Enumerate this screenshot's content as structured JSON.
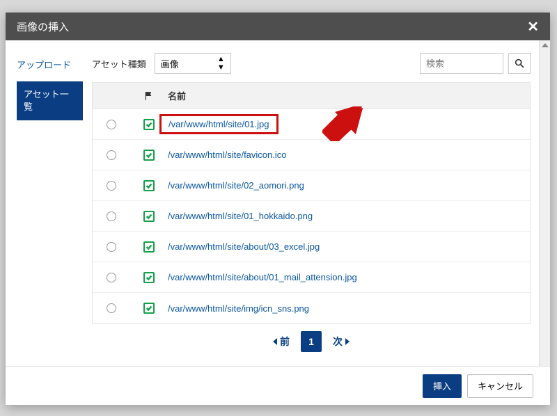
{
  "modal": {
    "title": "画像の挿入"
  },
  "sidebar": {
    "upload_label": "アップロード",
    "asset_list_label": "アセット一覧"
  },
  "toolbar": {
    "asset_type_label": "アセット種類",
    "asset_type_value": "画像",
    "search_placeholder": "検索"
  },
  "table": {
    "name_header": "名前",
    "rows": [
      {
        "name": "/var/www/html/site/01.jpg",
        "highlight": true
      },
      {
        "name": "/var/www/html/site/favicon.ico"
      },
      {
        "name": "/var/www/html/site/02_aomori.png"
      },
      {
        "name": "/var/www/html/site/01_hokkaido.png"
      },
      {
        "name": "/var/www/html/site/about/03_excel.jpg"
      },
      {
        "name": "/var/www/html/site/about/01_mail_attension.jpg"
      },
      {
        "name": "/var/www/html/site/img/icn_sns.png"
      }
    ]
  },
  "pager": {
    "prev_label": "前",
    "current": "1",
    "next_label": "次"
  },
  "footer": {
    "insert_label": "挿入",
    "cancel_label": "キャンセル"
  }
}
